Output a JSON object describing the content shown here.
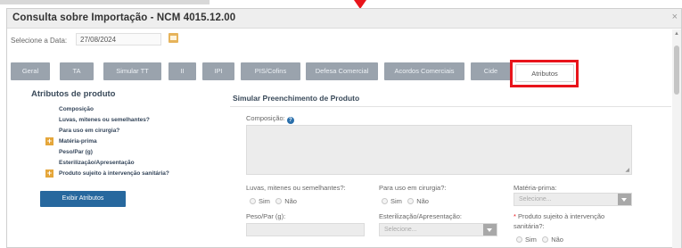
{
  "modal": {
    "title": "Consulta sobre Importação - NCM 4015.12.00",
    "close_glyph": "×"
  },
  "date": {
    "label": "Selecione a Data:",
    "value": "27/08/2024",
    "icon": "calendar-icon"
  },
  "tabs": [
    {
      "label": "Geral",
      "active": false
    },
    {
      "label": "TA",
      "active": false
    },
    {
      "label": "Simular TT",
      "active": false
    },
    {
      "label": "II",
      "active": false
    },
    {
      "label": "IPI",
      "active": false
    },
    {
      "label": "PIS/Cofins",
      "active": false
    },
    {
      "label": "Defesa Comercial",
      "active": false
    },
    {
      "label": "Acordos Comerciais",
      "active": false
    },
    {
      "label": "Cide",
      "active": false
    },
    {
      "label": "Atributos",
      "active": true
    }
  ],
  "attributes_panel": {
    "title": "Atributos de produto",
    "items": [
      {
        "label": "Composição",
        "expandable": false
      },
      {
        "label": "Luvas, mitenes ou semelhantes?",
        "expandable": false
      },
      {
        "label": "Para uso em cirurgia?",
        "expandable": false
      },
      {
        "label": "Matéria-prima",
        "expandable": true
      },
      {
        "label": "Peso/Par (g)",
        "expandable": false
      },
      {
        "label": "Esterilização/Apresentação",
        "expandable": false
      },
      {
        "label": "Produto sujeito à intervenção sanitária?",
        "expandable": true
      }
    ],
    "button_label": "Exibir Atributos",
    "plus_glyph": "+"
  },
  "simulate_panel": {
    "title": "Simular Preenchimento de Produto",
    "composicao_label": "Composição:",
    "help_glyph": "?",
    "fields": {
      "luvas_label": "Luvas, mitenes ou semelhantes?:",
      "cirurgia_label": "Para uso em cirurgia?:",
      "materia_label": "Matéria-prima:",
      "materia_placeholder": "Selecione...",
      "peso_label": "Peso/Par (g):",
      "esterilizacao_label": "Esterilização/Apresentação:",
      "esterilizacao_placeholder": "Selecione...",
      "sanitaria_label_line1": "Produto sujeito à intervenção",
      "sanitaria_label_line2": "sanitária?:",
      "required_mark": "*"
    },
    "radio_yes": "Sim",
    "radio_no": "Não"
  },
  "colors": {
    "tab_inactive": "#9aa3ad",
    "primary_button": "#27689e",
    "highlight_red": "#e8141b",
    "plus_orange": "#e5a63a"
  }
}
